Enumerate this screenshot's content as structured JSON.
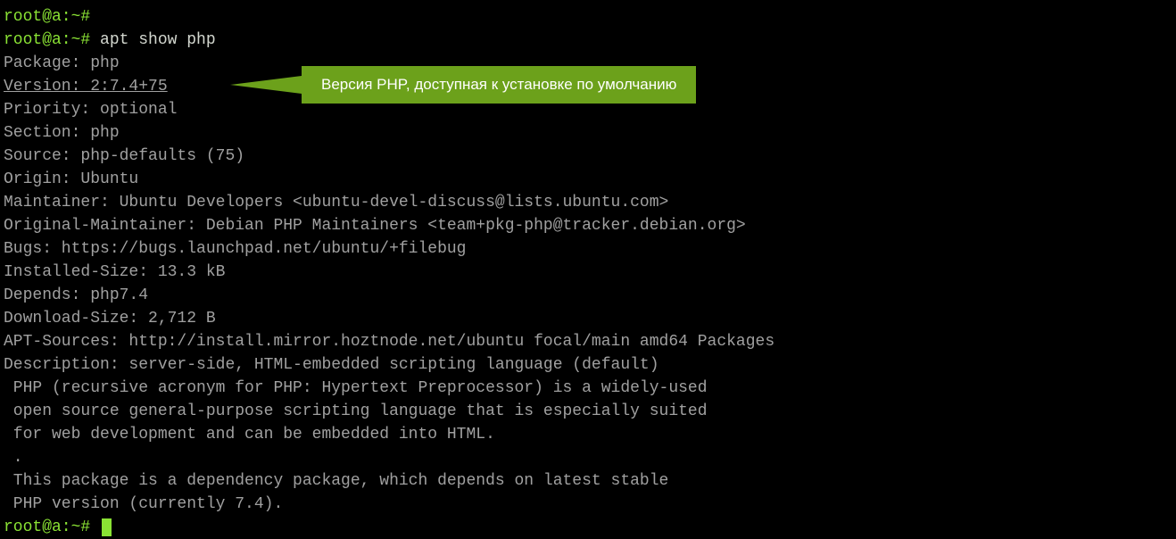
{
  "prompt_user": "root",
  "prompt_host": "a",
  "prompt_path": "~",
  "prompt_suffix": "#",
  "lines": {
    "l1": "root@a:~#",
    "l2_cmd": " apt show php",
    "package": "Package: php",
    "version": "Version: 2:7.4+75",
    "priority": "Priority: optional",
    "section": "Section: php",
    "source": "Source: php-defaults (75)",
    "origin": "Origin: Ubuntu",
    "maintainer": "Maintainer: Ubuntu Developers <ubuntu-devel-discuss@lists.ubuntu.com>",
    "orig_maintainer": "Original-Maintainer: Debian PHP Maintainers <team+pkg-php@tracker.debian.org>",
    "bugs": "Bugs: https://bugs.launchpad.net/ubuntu/+filebug",
    "installed_size": "Installed-Size: 13.3 kB",
    "depends": "Depends: php7.4",
    "download_size": "Download-Size: 2,712 B",
    "apt_sources": "APT-Sources: http://install.mirror.hoztnode.net/ubuntu focal/main amd64 Packages",
    "desc0": "Description: server-side, HTML-embedded scripting language (default)",
    "desc1": " PHP (recursive acronym for PHP: Hypertext Preprocessor) is a widely-used",
    "desc2": " open source general-purpose scripting language that is especially suited",
    "desc3": " for web development and can be embedded into HTML.",
    "desc4": " .",
    "desc5": " This package is a dependency package, which depends on latest stable",
    "desc6": " PHP version (currently 7.4).",
    "blank": "",
    "last_prompt": "root@a:~# "
  },
  "callout_text": "Версия PHP, доступная к установке по умолчанию"
}
